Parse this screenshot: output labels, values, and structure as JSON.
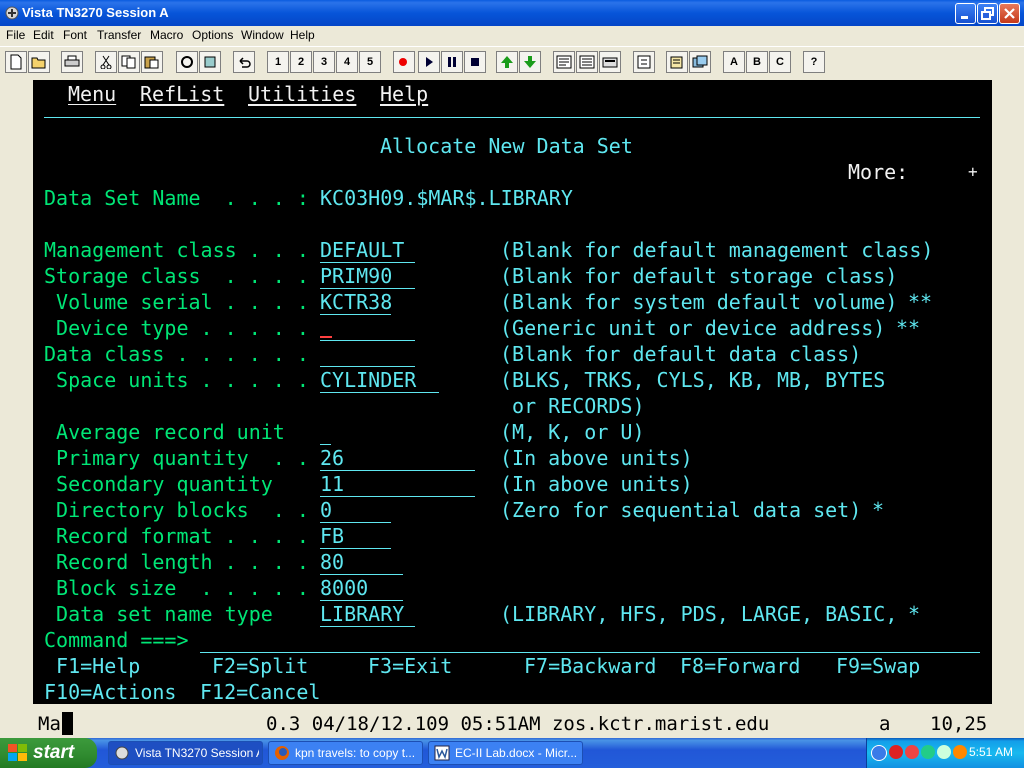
{
  "window": {
    "title": "Vista TN3270 Session A"
  },
  "menubar": [
    "File",
    "Edit",
    "Font",
    "Transfer",
    "Macro",
    "Options",
    "Window",
    "Help"
  ],
  "toolbar": {
    "macro_numbers": [
      "1",
      "2",
      "3",
      "4",
      "5"
    ],
    "abc": [
      "A",
      "B",
      "C"
    ],
    "help": "?"
  },
  "terminal": {
    "menu": [
      "Menu",
      "RefList",
      "Utilities",
      "Help"
    ],
    "panel_title": "Allocate New Data Set",
    "more": "More:",
    "more_sign": "+",
    "dsn_label": "Data Set Name  . . . :",
    "dsn_value": "KC03H09.$MAR$.LIBRARY",
    "rows": [
      {
        "label": "Management class . . .",
        "value": "DEFAULT",
        "help": "(Blank for default management class)",
        "mark": ""
      },
      {
        "label": "Storage class  . . . .",
        "value": "PRIM90",
        "help": "(Blank for default storage class)",
        "mark": ""
      },
      {
        "label": " Volume serial . . . .",
        "value": "KCTR38",
        "help": "(Blank for system default volume)",
        "mark": "**"
      },
      {
        "label": " Device type . . . . .",
        "value": "",
        "help": "(Generic unit or device address)",
        "mark": "**"
      },
      {
        "label": "Data class . . . . . .",
        "value": "",
        "help": "(Blank for default data class)",
        "mark": ""
      },
      {
        "label": " Space units . . . . .",
        "value": "CYLINDER",
        "help": "(BLKS, TRKS, CYLS, KB, MB, BYTES",
        "mark": ""
      },
      {
        "label": "",
        "value": "",
        "help": " or RECORDS)",
        "mark": ""
      },
      {
        "label": " Average record unit",
        "value": "",
        "help": "(M, K, or U)",
        "mark": ""
      },
      {
        "label": " Primary quantity  . .",
        "value": "26",
        "help": "(In above units)",
        "mark": ""
      },
      {
        "label": " Secondary quantity",
        "value": "11",
        "help": "(In above units)",
        "mark": ""
      },
      {
        "label": " Directory blocks  . .",
        "value": "0",
        "help": "(Zero for sequential data set)",
        "mark": "*"
      },
      {
        "label": " Record format . . . .",
        "value": "FB",
        "help": "",
        "mark": ""
      },
      {
        "label": " Record length . . . .",
        "value": "80",
        "help": "",
        "mark": ""
      },
      {
        "label": " Block size  . . . . .",
        "value": "8000",
        "help": "",
        "mark": ""
      },
      {
        "label": " Data set name type",
        "value": "LIBRARY",
        "help": "(LIBRARY, HFS, PDS, LARGE, BASIC,",
        "mark": "*"
      }
    ],
    "command_label": "Command ===>",
    "command_value": "",
    "fkeys_row1": [
      " F1=Help",
      "F2=Split",
      "F3=Exit",
      "F7=Backward",
      "F8=Forward",
      "F9=Swap"
    ],
    "fkeys_row2": [
      "F10=Actions",
      "F12=Cancel"
    ]
  },
  "status": {
    "left": "Ma",
    "center": "0.3 04/18/12.109 05:51AM zos.kctr.marist.edu",
    "mode": "a",
    "position": "10,25"
  },
  "taskbar": {
    "start": "start",
    "tasks": [
      {
        "label": "Vista TN3270 Session A",
        "icon": "terminal-icon"
      },
      {
        "label": "kpn travels: to copy t...",
        "icon": "firefox-icon"
      },
      {
        "label": "EC-II Lab.docx - Micr...",
        "icon": "word-icon"
      }
    ],
    "clock": "5:51 AM"
  }
}
